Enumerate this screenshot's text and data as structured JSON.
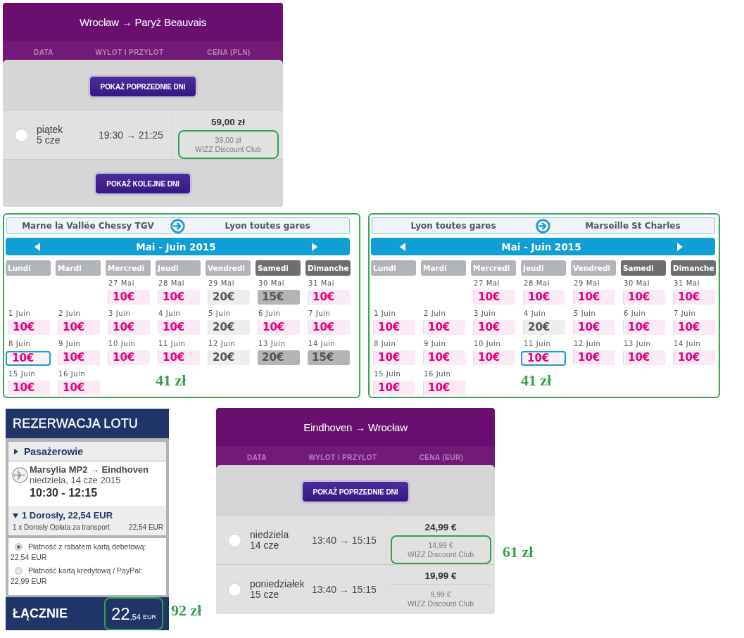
{
  "flight_panels": [
    {
      "title": "Wrocław → Paryż Beauvais",
      "columns": [
        "DATA",
        "WYLOT I PRZYLOT",
        "CENA (PLN)"
      ],
      "previous_button": "POKAŻ POPRZEDNIE DNI",
      "flights": [
        {
          "day": "piątek",
          "date": "5 cze",
          "times": "19:30 → 21:25",
          "selected": false,
          "price": "59,00 zł",
          "club_price": "39,00 zł",
          "club_label": "WIZZ Discount Club",
          "highlighted": true
        }
      ],
      "next_button": "POKAŻ KOLEJNE DNI"
    },
    {
      "title": "Eindhoven → Wrocław",
      "columns": [
        "DATA",
        "WYLOT I PRZYLOT",
        "CENA (EUR)"
      ],
      "previous_button": "POKAŻ POPRZEDNIE DNI",
      "flights": [
        {
          "day": "niedziela",
          "date": "14 cze",
          "times": "13:40 → 15:15",
          "selected": false,
          "price": "24,99 €",
          "club_price": "14,99 €",
          "club_label": "WIZZ Discount Club",
          "highlighted": true,
          "note": "61 zł"
        },
        {
          "day": "poniedziałek",
          "date": "15 cze",
          "times": "13:40 → 15:15",
          "selected": false,
          "price": "19,99 €",
          "club_price": "9,99 €",
          "club_label": "WIZZ Discount Club",
          "highlighted": false
        }
      ]
    }
  ],
  "train_calendars": [
    {
      "highlighted": true,
      "from": "Marne la Vallée Chessy TGV",
      "to": "Lyon toutes gares",
      "month": "Mai - Juin 2015",
      "weekdays": [
        {
          "label": "Lundi",
          "weekend": false
        },
        {
          "label": "Mardi",
          "weekend": false
        },
        {
          "label": "Mercredi",
          "weekend": false
        },
        {
          "label": "Jeudi",
          "weekend": false
        },
        {
          "label": "Vendredi",
          "weekend": false
        },
        {
          "label": "Samedi",
          "weekend": true
        },
        {
          "label": "Dimanche",
          "weekend": true
        }
      ],
      "weeks": [
        [
          {
            "date": "27 Mai",
            "price": "10€",
            "kind": "promo",
            "selected": false
          },
          {
            "date": "28 Mai",
            "price": "10€",
            "kind": "promo",
            "selected": false
          },
          {
            "date": "29 Mai",
            "price": "20€",
            "kind": "standard",
            "selected": false
          },
          {
            "date": "30 Mai",
            "price": "15€",
            "kind": "muted",
            "selected": false
          },
          {
            "date": "31 Mai",
            "price": "10€",
            "kind": "promo",
            "selected": false
          }
        ],
        [
          {
            "date": "1 Juin",
            "price": "10€",
            "kind": "promo",
            "selected": false
          },
          {
            "date": "2 Juin",
            "price": "10€",
            "kind": "promo",
            "selected": false
          },
          {
            "date": "3 Juin",
            "price": "10€",
            "kind": "promo",
            "selected": false
          },
          {
            "date": "4 Juin",
            "price": "10€",
            "kind": "promo",
            "selected": false
          },
          {
            "date": "5 Juin",
            "price": "20€",
            "kind": "standard",
            "selected": false
          },
          {
            "date": "6 Juin",
            "price": "10€",
            "kind": "promo",
            "selected": false
          },
          {
            "date": "7 Juin",
            "price": "10€",
            "kind": "promo",
            "selected": false
          }
        ],
        [
          {
            "date": "8 Juin",
            "price": "10€",
            "kind": "promo",
            "selected": true
          },
          {
            "date": "9 Juin",
            "price": "10€",
            "kind": "promo",
            "selected": false
          },
          {
            "date": "10 Juin",
            "price": "10€",
            "kind": "promo",
            "selected": false
          },
          {
            "date": "11 Juin",
            "price": "10€",
            "kind": "promo",
            "selected": false
          },
          {
            "date": "12 Juin",
            "price": "20€",
            "kind": "standard",
            "selected": false
          },
          {
            "date": "13 Juin",
            "price": "20€",
            "kind": "muted",
            "selected": false
          },
          {
            "date": "14 Juin",
            "price": "15€",
            "kind": "muted",
            "selected": false
          }
        ],
        [
          {
            "date": "15 Juin",
            "price": "10€",
            "kind": "promo",
            "selected": false
          },
          {
            "date": "16 Juin",
            "price": "10€",
            "kind": "promo",
            "selected": false
          }
        ]
      ],
      "note": "41 zł"
    },
    {
      "highlighted": true,
      "from": "Lyon toutes gares",
      "to": "Marseille St Charles",
      "month": "Mai - Juin 2015",
      "weekdays": [
        {
          "label": "Lundi",
          "weekend": false
        },
        {
          "label": "Mardi",
          "weekend": false
        },
        {
          "label": "Mercredi",
          "weekend": false
        },
        {
          "label": "Jeudi",
          "weekend": false
        },
        {
          "label": "Vendredi",
          "weekend": false
        },
        {
          "label": "Samedi",
          "weekend": true
        },
        {
          "label": "Dimanche",
          "weekend": true
        }
      ],
      "weeks": [
        [
          {
            "date": "27 Mai",
            "price": "10€",
            "kind": "promo",
            "selected": false
          },
          {
            "date": "28 Mai",
            "price": "10€",
            "kind": "promo",
            "selected": false
          },
          {
            "date": "29 Mai",
            "price": "10€",
            "kind": "promo",
            "selected": false
          },
          {
            "date": "30 Mai",
            "price": "10€",
            "kind": "promo",
            "selected": false
          },
          {
            "date": "31 Mai",
            "price": "10€",
            "kind": "promo",
            "selected": false
          }
        ],
        [
          {
            "date": "1 Juin",
            "price": "10€",
            "kind": "promo",
            "selected": false
          },
          {
            "date": "2 Juin",
            "price": "10€",
            "kind": "promo",
            "selected": false
          },
          {
            "date": "3 Juin",
            "price": "10€",
            "kind": "promo",
            "selected": false
          },
          {
            "date": "4 Juin",
            "price": "20€",
            "kind": "standard",
            "selected": false
          },
          {
            "date": "5 Juin",
            "price": "10€",
            "kind": "promo",
            "selected": false
          },
          {
            "date": "6 Juin",
            "price": "10€",
            "kind": "promo",
            "selected": false
          },
          {
            "date": "7 Juin",
            "price": "10€",
            "kind": "promo",
            "selected": false
          }
        ],
        [
          {
            "date": "8 Juin",
            "price": "10€",
            "kind": "promo",
            "selected": false
          },
          {
            "date": "9 Juin",
            "price": "10€",
            "kind": "promo",
            "selected": false
          },
          {
            "date": "10 Juin",
            "price": "10€",
            "kind": "promo",
            "selected": false
          },
          {
            "date": "11 Juin",
            "price": "10€",
            "kind": "promo",
            "selected": true
          },
          {
            "date": "12 Juin",
            "price": "10€",
            "kind": "promo",
            "selected": false
          },
          {
            "date": "13 Juin",
            "price": "10€",
            "kind": "promo",
            "selected": false
          },
          {
            "date": "14 Juin",
            "price": "10€",
            "kind": "promo",
            "selected": false
          }
        ],
        [
          {
            "date": "15 Juin",
            "price": "10€",
            "kind": "promo",
            "selected": false
          },
          {
            "date": "16 Juin",
            "price": "10€",
            "kind": "promo",
            "selected": false
          }
        ]
      ],
      "note": "41 zł"
    }
  ],
  "booking": {
    "title": "REZERWACJA LOTU",
    "passengers": {
      "label": "Pasażerowie",
      "expanded": false
    },
    "flight": {
      "route": "Marsylia MP2 → Eindhoven",
      "date": "niedziela, 14 cze 2015",
      "times": "10:30 - 12:15"
    },
    "fare": {
      "summary": "1 Dorosły, 22,54 EUR",
      "expanded": true,
      "line_label": "1 x Dorosły Opłata za transport",
      "line_amount": "22,54 EUR"
    },
    "payment_options": [
      {
        "label": "Płatność z rabatem kartą debetową:",
        "amount": "22,54 EUR",
        "selected": true
      },
      {
        "label": "Płatność kartą kredytową / PayPal:",
        "amount": "22,99 EUR",
        "selected": false
      }
    ],
    "total": {
      "label": "ŁĄCZNIE",
      "whole": "22",
      "fraction": ",54",
      "currency": "EUR",
      "highlighted": true
    },
    "note": "92 zł"
  }
}
